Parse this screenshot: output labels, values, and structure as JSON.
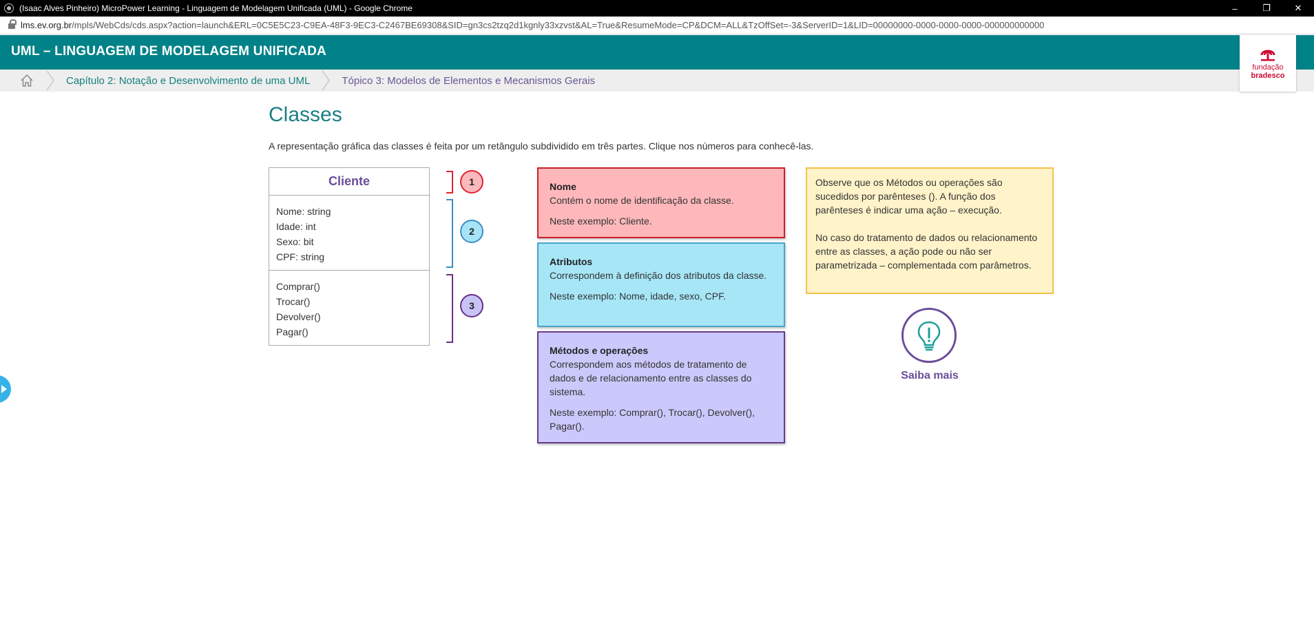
{
  "window": {
    "title": "(Isaac Alves Pinheiro) MicroPower Learning - Linguagem de Modelagem Unificada (UML) - Google Chrome",
    "controls": [
      "–",
      "❐",
      "✕"
    ]
  },
  "address": {
    "host": "lms.ev.org.br",
    "path": "/mpls/WebCds/cds.aspx?action=launch&ERL=0C5E5C23-C9EA-48F3-9EC3-C2467BE69308&SID=gn3cs2tzq2d1kgnly33xzvst&AL=True&ResumeMode=CP&DCM=ALL&TzOffSet=-3&ServerID=1&LID=00000000-0000-0000-0000-000000000000"
  },
  "header": {
    "title": "UML – LINGUAGEM DE MODELAGEM UNIFICADA",
    "logo_line1": "fundação",
    "logo_line2": "bradesco",
    "brand_color": "#008288"
  },
  "breadcrumb": {
    "home_icon": "home-icon",
    "items": [
      "Capítulo 2: Notação e Desenvolvimento de uma UML",
      "Tópico 3: Modelos de Elementos e Mecanismos Gerais"
    ]
  },
  "content": {
    "title": "Classes",
    "intro": "A representação gráfica das classes é feita por um retângulo subdividido em três partes. Clique nos números para conhecê-las."
  },
  "uml_class": {
    "name": "Cliente",
    "attributes": [
      "Nome: string",
      "Idade: int",
      "Sexo: bit",
      "CPF: string"
    ],
    "operations": [
      "Comprar()",
      "Trocar()",
      "Devolver()",
      "Pagar()"
    ]
  },
  "markers": [
    {
      "label": "1",
      "color": "#e02333",
      "fill": "#fbb9bd"
    },
    {
      "label": "2",
      "color": "#3b8fc6",
      "fill": "#a7e4f7"
    },
    {
      "label": "3",
      "color": "#6a2f86",
      "fill": "#c7c3f7"
    }
  ],
  "info_boxes": [
    {
      "heading": "Nome",
      "body": "Contém o nome de identificação da classe.",
      "example": "Neste exemplo: Cliente.",
      "bg": "#feb8bb",
      "border": "#cc1f2b"
    },
    {
      "heading": "Atributos",
      "body": "Correspondem à definição dos atributos da classe.",
      "example": "Neste exemplo: Nome, idade, sexo, CPF.",
      "bg": "#a6e6f7",
      "border": "#4aa3c9"
    },
    {
      "heading": "Métodos e operações",
      "body": "Correspondem aos métodos de tratamento de dados e de relacionamento entre as classes do sistema.",
      "example": "Neste exemplo: Comprar(), Trocar(), Devolver(), Pagar().",
      "bg": "#cbc9fb",
      "border": "#6a3a8a"
    }
  ],
  "note": {
    "paragraph1": "Observe que os Métodos ou operações são sucedidos por parênteses (). A função dos parênteses é indicar uma ação – execução.",
    "paragraph2": "No caso do tratamento de dados ou relacionamento entre as classes, a ação pode ou não ser parametrizada – complementada com parâmetros."
  },
  "saiba_mais": {
    "label": "Saiba mais",
    "icon": "lightbulb-icon"
  },
  "side_toggle": {
    "icon": "arrow-right-icon"
  }
}
